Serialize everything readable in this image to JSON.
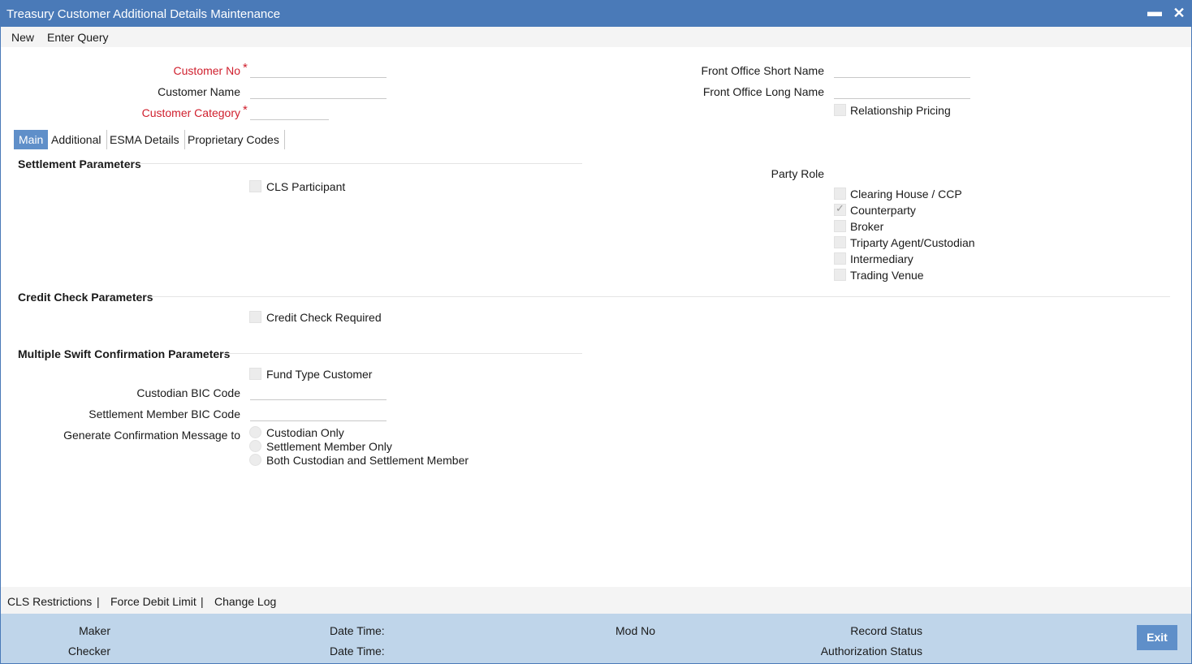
{
  "window": {
    "title": "Treasury Customer Additional Details Maintenance",
    "minimize_glyph": "▬",
    "close_glyph": "✕"
  },
  "menu": {
    "new": "New",
    "enter_query": "Enter Query"
  },
  "header_fields": {
    "customer_no": {
      "label": "Customer No",
      "value": "",
      "required": true
    },
    "customer_name": {
      "label": "Customer Name",
      "value": ""
    },
    "customer_category": {
      "label": "Customer Category",
      "value": "",
      "required": true
    },
    "front_office_short_name": {
      "label": "Front Office Short Name",
      "value": ""
    },
    "front_office_long_name": {
      "label": "Front Office Long Name",
      "value": ""
    },
    "relationship_pricing": {
      "label": "Relationship Pricing",
      "checked": false
    }
  },
  "required_marker": "*",
  "tabs": [
    {
      "label": "Main",
      "active": true
    },
    {
      "label": "Additional",
      "active": false
    },
    {
      "label": "ESMA Details",
      "active": false
    },
    {
      "label": "Proprietary Codes",
      "active": false
    }
  ],
  "settlement": {
    "heading": "Settlement Parameters",
    "cls_participant": {
      "label": "CLS Participant",
      "checked": false
    }
  },
  "party_role": {
    "heading": "Party Role",
    "options": [
      {
        "label": "Clearing House / CCP",
        "checked": false
      },
      {
        "label": "Counterparty",
        "checked": true
      },
      {
        "label": "Broker",
        "checked": false
      },
      {
        "label": "Triparty Agent/Custodian",
        "checked": false
      },
      {
        "label": "Intermediary",
        "checked": false
      },
      {
        "label": "Trading Venue",
        "checked": false
      }
    ]
  },
  "credit_check": {
    "heading": "Credit Check Parameters",
    "required": {
      "label": "Credit Check Required",
      "checked": false
    }
  },
  "swift": {
    "heading": "Multiple Swift Confirmation Parameters",
    "fund_type_customer": {
      "label": "Fund Type Customer",
      "checked": false
    },
    "custodian_bic": {
      "label": "Custodian BIC Code",
      "value": ""
    },
    "settlement_member_bic": {
      "label": "Settlement Member BIC Code",
      "value": ""
    },
    "generate_label": "Generate Confirmation Message to",
    "generate_options": [
      {
        "label": "Custodian Only",
        "selected": false
      },
      {
        "label": "Settlement Member Only",
        "selected": false
      },
      {
        "label": "Both Custodian and Settlement Member",
        "selected": false
      }
    ]
  },
  "footer_links": {
    "cls_restrictions": "CLS Restrictions",
    "sep1": "|",
    "force_debit_limit": "Force Debit Limit",
    "sep2": "|",
    "change_log": "Change Log"
  },
  "status": {
    "maker": "Maker",
    "checker": "Checker",
    "date_time_1": "Date Time:",
    "date_time_2": "Date Time:",
    "mod_no": "Mod No",
    "record_status": "Record Status",
    "authorization_status": "Authorization Status",
    "exit": "Exit"
  },
  "colors": {
    "title_bar": "#4a7ab8",
    "active_tab": "#5f8fc9",
    "status_bar": "#bfd5ea",
    "required": "#d0202e"
  }
}
